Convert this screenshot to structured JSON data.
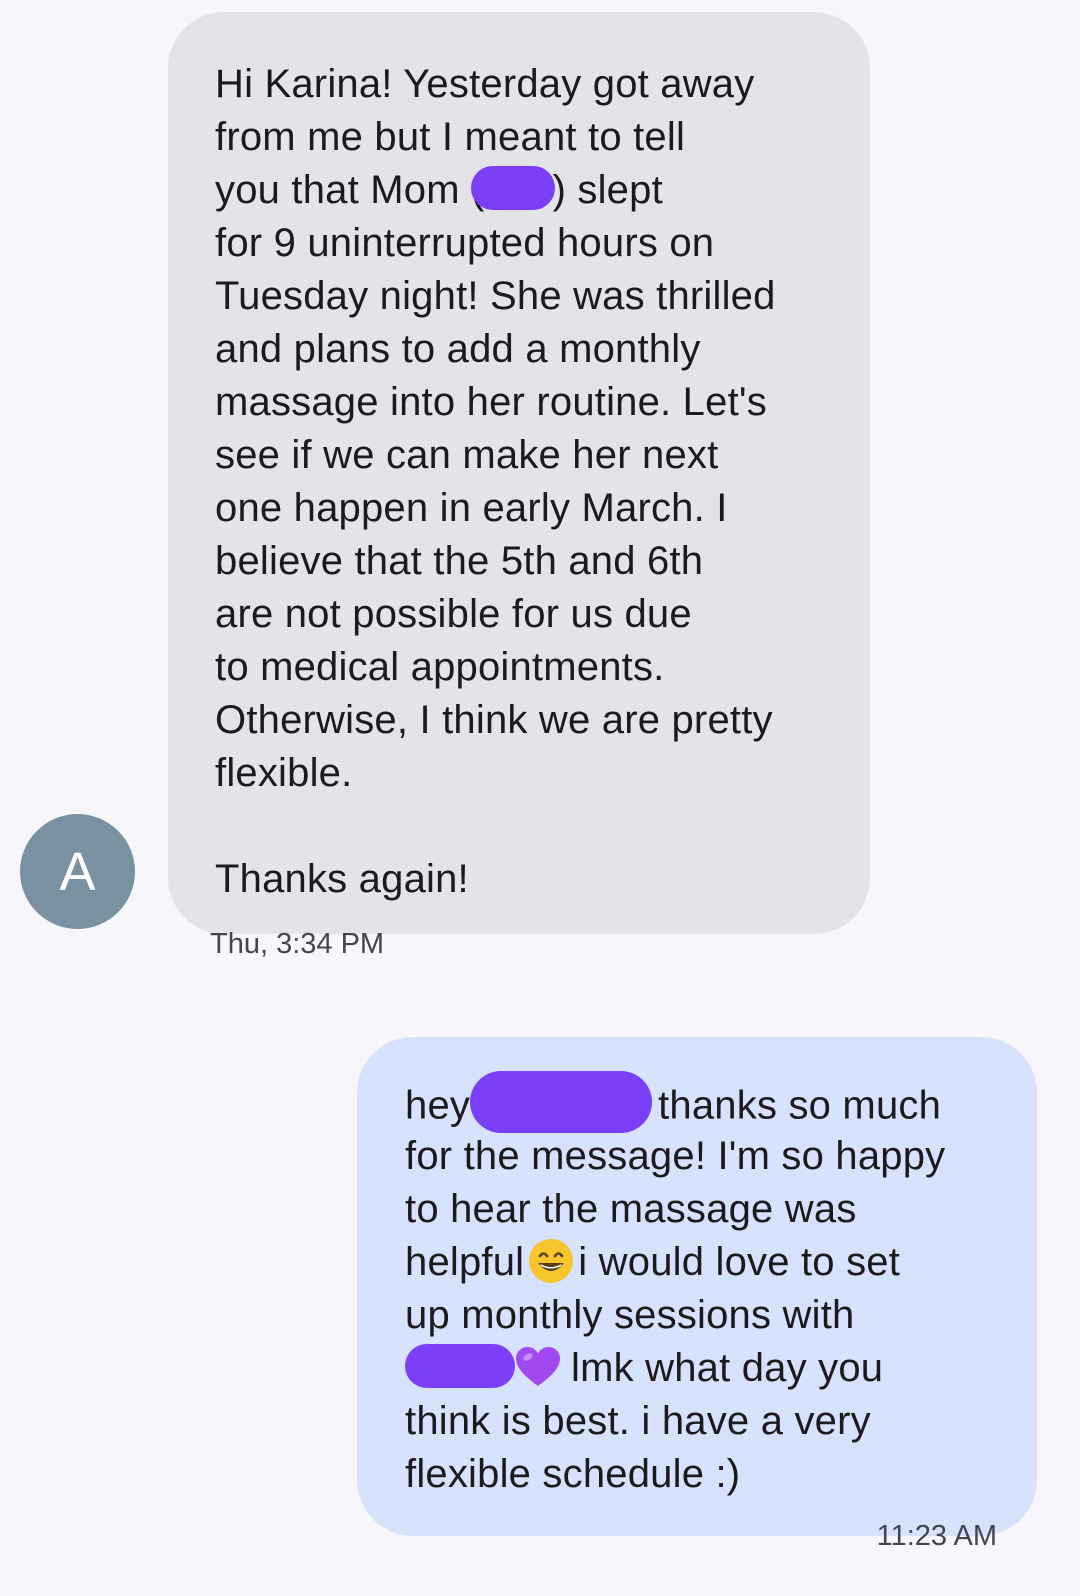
{
  "conversation": {
    "incoming": {
      "avatar_letter": "A",
      "lines": {
        "l1": "Hi Karina! Yesterday got away",
        "l2": "from me but I meant to tell",
        "l3a": "you that Mom (",
        "l3b": ") slept",
        "l4": "for 9 uninterrupted hours on",
        "l5": "Tuesday night! She was thrilled",
        "l6": "and plans to add a monthly",
        "l7": "massage into her routine. Let's",
        "l8": "see if we can make her next",
        "l9": "one happen in early March. I",
        "l10": "believe that the 5th and 6th",
        "l11": "are not possible for us due",
        "l12": "to medical appointments.",
        "l13": "Otherwise, I think we are pretty",
        "l14": "flexible.",
        "l15": "Thanks again!"
      },
      "timestamp": "Thu, 3:34 PM"
    },
    "outgoing": {
      "lines": {
        "l1a": "hey",
        "l1b": "thanks so much",
        "l2": "for the message! I'm so happy",
        "l3": "to hear the massage was",
        "l4a": "helpful",
        "l4b": "i would love to set",
        "l5": "up monthly sessions with",
        "l6": "lmk what day you",
        "l7": "think is best. i have a very",
        "l8": "flexible schedule :)"
      },
      "emoji": [
        "grinning-face-icon",
        "purple-heart-icon"
      ],
      "timestamp": "11:23 AM"
    },
    "colors": {
      "background": "#f7f7fb",
      "incoming_bubble": "#e3e3e8",
      "outgoing_bubble": "#d7e3fd",
      "avatar": "#7991a1",
      "redaction": "#7a3ff7"
    }
  }
}
